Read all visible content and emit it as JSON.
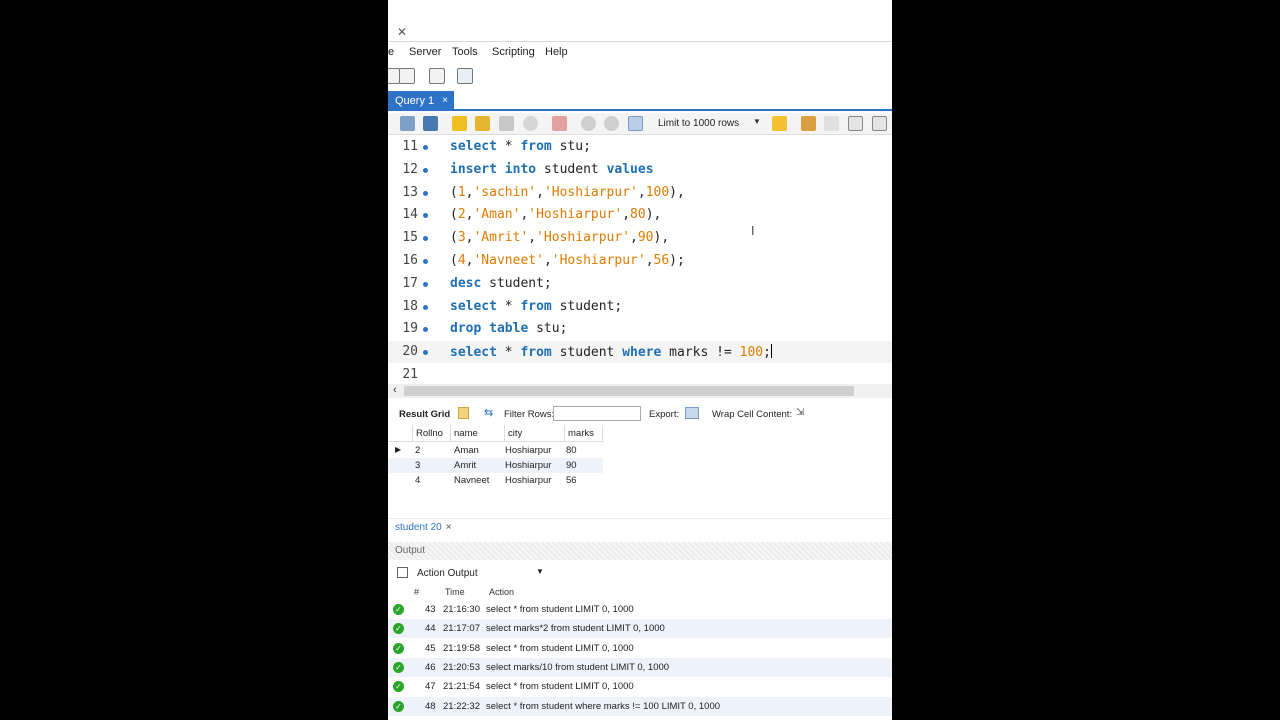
{
  "menu": [
    "e",
    "Server",
    "Tools",
    "Scripting",
    "Help"
  ],
  "tab": {
    "label": "Query 1",
    "close": "×"
  },
  "editor_toolbar": {
    "limit": "Limit to 1000 rows"
  },
  "editor": {
    "lines": [
      {
        "num": "11",
        "tokens": [
          [
            "kw",
            "select"
          ],
          [
            "id",
            " * "
          ],
          [
            "kw",
            "from"
          ],
          [
            "id",
            " stu;"
          ]
        ]
      },
      {
        "num": "12",
        "tokens": [
          [
            "kw",
            "insert"
          ],
          [
            "id",
            " "
          ],
          [
            "kw",
            "into"
          ],
          [
            "id",
            " student "
          ],
          [
            "kw",
            "values"
          ]
        ]
      },
      {
        "num": "13",
        "tokens": [
          [
            "id",
            "("
          ],
          [
            "num",
            "1"
          ],
          [
            "id",
            ","
          ],
          [
            "str",
            "'sachin'"
          ],
          [
            "id",
            ","
          ],
          [
            "str",
            "'Hoshiarpur'"
          ],
          [
            "id",
            ","
          ],
          [
            "num",
            "100"
          ],
          [
            "id",
            "),"
          ]
        ]
      },
      {
        "num": "14",
        "tokens": [
          [
            "id",
            "("
          ],
          [
            "num",
            "2"
          ],
          [
            "id",
            ","
          ],
          [
            "str",
            "'Aman'"
          ],
          [
            "id",
            ","
          ],
          [
            "str",
            "'Hoshiarpur'"
          ],
          [
            "id",
            ","
          ],
          [
            "num",
            "80"
          ],
          [
            "id",
            "),"
          ]
        ]
      },
      {
        "num": "15",
        "tokens": [
          [
            "id",
            "("
          ],
          [
            "num",
            "3"
          ],
          [
            "id",
            ","
          ],
          [
            "str",
            "'Amrit'"
          ],
          [
            "id",
            ","
          ],
          [
            "str",
            "'Hoshiarpur'"
          ],
          [
            "id",
            ","
          ],
          [
            "num",
            "90"
          ],
          [
            "id",
            "),"
          ]
        ]
      },
      {
        "num": "16",
        "tokens": [
          [
            "id",
            "("
          ],
          [
            "num",
            "4"
          ],
          [
            "id",
            ","
          ],
          [
            "str",
            "'Navneet'"
          ],
          [
            "id",
            ","
          ],
          [
            "str",
            "'Hoshiarpur'"
          ],
          [
            "id",
            ","
          ],
          [
            "num",
            "56"
          ],
          [
            "id",
            ");"
          ]
        ]
      },
      {
        "num": "17",
        "tokens": [
          [
            "kw",
            "desc"
          ],
          [
            "id",
            " student;"
          ]
        ]
      },
      {
        "num": "18",
        "tokens": [
          [
            "kw",
            "select"
          ],
          [
            "id",
            " * "
          ],
          [
            "kw",
            "from"
          ],
          [
            "id",
            " student;"
          ]
        ]
      },
      {
        "num": "19",
        "tokens": [
          [
            "kw",
            "drop"
          ],
          [
            "id",
            " "
          ],
          [
            "kw",
            "table"
          ],
          [
            "id",
            " stu;"
          ]
        ]
      },
      {
        "num": "20",
        "tokens": [
          [
            "kw",
            "select"
          ],
          [
            "id",
            " * "
          ],
          [
            "kw",
            "from"
          ],
          [
            "id",
            " student "
          ],
          [
            "kw",
            "where"
          ],
          [
            "id",
            " marks != "
          ],
          [
            "num",
            "100"
          ],
          [
            "id",
            ";"
          ]
        ]
      },
      {
        "num": "21",
        "tokens": []
      }
    ]
  },
  "result_toolbar": {
    "result_grid": "Result Grid",
    "filter_rows": "Filter Rows:",
    "export": "Export:",
    "wrap": "Wrap Cell Content:"
  },
  "grid": {
    "columns": [
      "Rollno",
      "name",
      "city",
      "marks"
    ],
    "rows": [
      [
        "2",
        "Aman",
        "Hoshiarpur",
        "80"
      ],
      [
        "3",
        "Amrit",
        "Hoshiarpur",
        "90"
      ],
      [
        "4",
        "Navneet",
        "Hoshiarpur",
        "56"
      ]
    ]
  },
  "status_tab": {
    "label": "student 20",
    "close": "×"
  },
  "output": {
    "title": "Output",
    "selector": "Action Output",
    "headers": [
      "#",
      "Time",
      "Action"
    ],
    "rows": [
      [
        "43",
        "21:16:30",
        "select * from student LIMIT 0, 1000"
      ],
      [
        "44",
        "21:17:07",
        "select marks*2 from student LIMIT 0, 1000"
      ],
      [
        "45",
        "21:19:58",
        "select * from student LIMIT 0, 1000"
      ],
      [
        "46",
        "21:20:53",
        "select marks/10 from student LIMIT 0, 1000"
      ],
      [
        "47",
        "21:21:54",
        "select * from student LIMIT 0, 1000"
      ],
      [
        "48",
        "21:22:32",
        "select * from student where marks != 100 LIMIT 0, 1000"
      ]
    ]
  }
}
